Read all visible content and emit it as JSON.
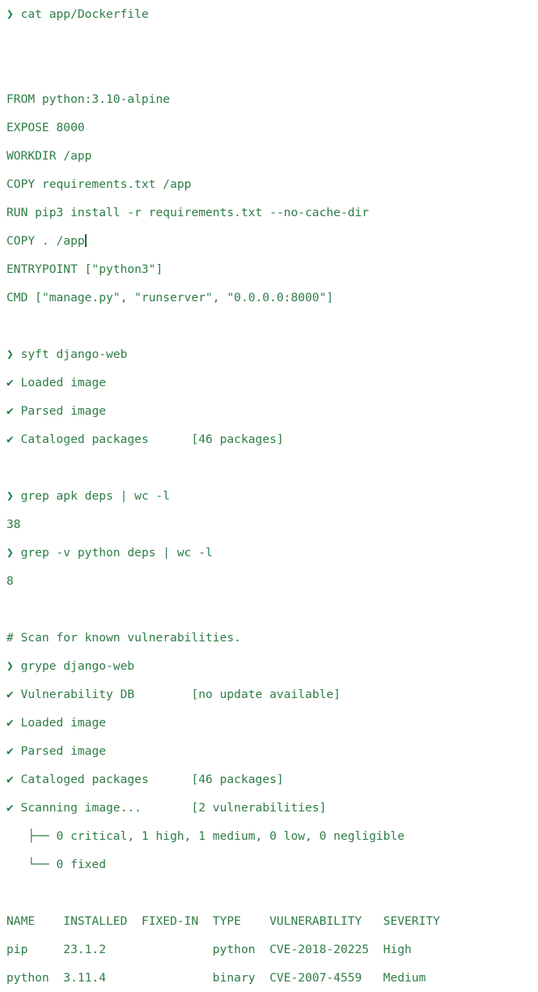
{
  "terminal": {
    "background_color": "#ffffff",
    "text_color": "#2d7d46",
    "prompt_color": "#15803d",
    "prompt_symbol": "❯",
    "check_symbol": "✔",
    "cursor_visible": true
  },
  "lines": [
    {
      "type": "command",
      "prompt": "❯",
      "text": " cat app/Dockerfile"
    },
    {
      "type": "blank",
      "text": ""
    },
    {
      "type": "blank",
      "text": ""
    },
    {
      "type": "output",
      "text": "FROM python:3.10-alpine"
    },
    {
      "type": "output",
      "text": "EXPOSE 8000"
    },
    {
      "type": "output",
      "text": "WORKDIR /app"
    },
    {
      "type": "output",
      "text": "COPY requirements.txt /app"
    },
    {
      "type": "output",
      "text": "RUN pip3 install -r requirements.txt --no-cache-dir"
    },
    {
      "type": "output-cursor",
      "text": "COPY . /app"
    },
    {
      "type": "output",
      "text": "ENTRYPOINT [\"python3\"]"
    },
    {
      "type": "output",
      "text": "CMD [\"manage.py\", \"runserver\", \"0.0.0.0:8000\"]"
    },
    {
      "type": "blank",
      "text": ""
    },
    {
      "type": "command",
      "prompt": "❯",
      "text": " syft django-web"
    },
    {
      "type": "status",
      "check": "✔",
      "text": " Loaded image"
    },
    {
      "type": "status",
      "check": "✔",
      "text": " Parsed image"
    },
    {
      "type": "status",
      "check": "✔",
      "text": " Cataloged packages      [46 packages]"
    },
    {
      "type": "blank",
      "text": ""
    },
    {
      "type": "command",
      "prompt": "❯",
      "text": " grep apk deps | wc -l"
    },
    {
      "type": "output",
      "text": "38"
    },
    {
      "type": "command",
      "prompt": "❯",
      "text": " grep -v python deps | wc -l"
    },
    {
      "type": "output",
      "text": "8"
    },
    {
      "type": "blank",
      "text": ""
    },
    {
      "type": "comment",
      "text": "# Scan for known vulnerabilities."
    },
    {
      "type": "command",
      "prompt": "❯",
      "text": " grype django-web"
    },
    {
      "type": "status",
      "check": "✔",
      "text": " Vulnerability DB        [no update available]"
    },
    {
      "type": "status",
      "check": "✔",
      "text": " Loaded image"
    },
    {
      "type": "status",
      "check": "✔",
      "text": " Parsed image"
    },
    {
      "type": "status",
      "check": "✔",
      "text": " Cataloged packages      [46 packages]"
    },
    {
      "type": "status",
      "check": "✔",
      "text": " Scanning image...       [2 vulnerabilities]"
    },
    {
      "type": "tree",
      "text": "   ├── 0 critical, 1 high, 1 medium, 0 low, 0 negligible"
    },
    {
      "type": "tree",
      "text": "   └── 0 fixed"
    },
    {
      "type": "blank",
      "text": ""
    },
    {
      "type": "table-header",
      "text": "NAME    INSTALLED  FIXED-IN  TYPE    VULNERABILITY   SEVERITY"
    },
    {
      "type": "table-row",
      "text": "pip     23.1.2               python  CVE-2018-20225  High"
    },
    {
      "type": "table-row",
      "text": "python  3.11.4               binary  CVE-2007-4559   Medium"
    }
  ],
  "dockerfile": {
    "from": "python:3.10-alpine",
    "expose": "8000",
    "workdir": "/app",
    "copy_requirements": "requirements.txt /app",
    "run": "pip3 install -r requirements.txt --no-cache-dir",
    "copy_all": ". /app",
    "entrypoint": "[\"python3\"]",
    "cmd": "[\"manage.py\", \"runserver\", \"0.0.0.0:8000\"]"
  },
  "syft_scan": {
    "command": "syft django-web",
    "steps": [
      {
        "label": "Loaded image",
        "value": ""
      },
      {
        "label": "Parsed image",
        "value": ""
      },
      {
        "label": "Cataloged packages",
        "value": "[46 packages]"
      }
    ]
  },
  "grep_checks": [
    {
      "command": "grep apk deps | wc -l",
      "result": "38"
    },
    {
      "command": "grep -v python deps | wc -l",
      "result": "8"
    }
  ],
  "grype_scan": {
    "comment": "# Scan for known vulnerabilities.",
    "command": "grype django-web",
    "steps": [
      {
        "label": "Vulnerability DB",
        "value": "[no update available]"
      },
      {
        "label": "Loaded image",
        "value": ""
      },
      {
        "label": "Parsed image",
        "value": ""
      },
      {
        "label": "Cataloged packages",
        "value": "[46 packages]"
      },
      {
        "label": "Scanning image...",
        "value": "[2 vulnerabilities]"
      }
    ],
    "summary": {
      "critical": "0",
      "high": "1",
      "medium": "1",
      "low": "0",
      "negligible": "0",
      "fixed": "0",
      "summary_line": "0 critical, 1 high, 1 medium, 0 low, 0 negligible",
      "fixed_line": "0 fixed"
    },
    "results_table": {
      "columns": [
        "NAME",
        "INSTALLED",
        "FIXED-IN",
        "TYPE",
        "VULNERABILITY",
        "SEVERITY"
      ],
      "rows": [
        {
          "name": "pip",
          "installed": "23.1.2",
          "fixed_in": "",
          "type": "python",
          "vulnerability": "CVE-2018-20225",
          "severity": "High"
        },
        {
          "name": "python",
          "installed": "3.11.4",
          "fixed_in": "",
          "type": "binary",
          "vulnerability": "CVE-2007-4559",
          "severity": "Medium"
        }
      ]
    }
  }
}
